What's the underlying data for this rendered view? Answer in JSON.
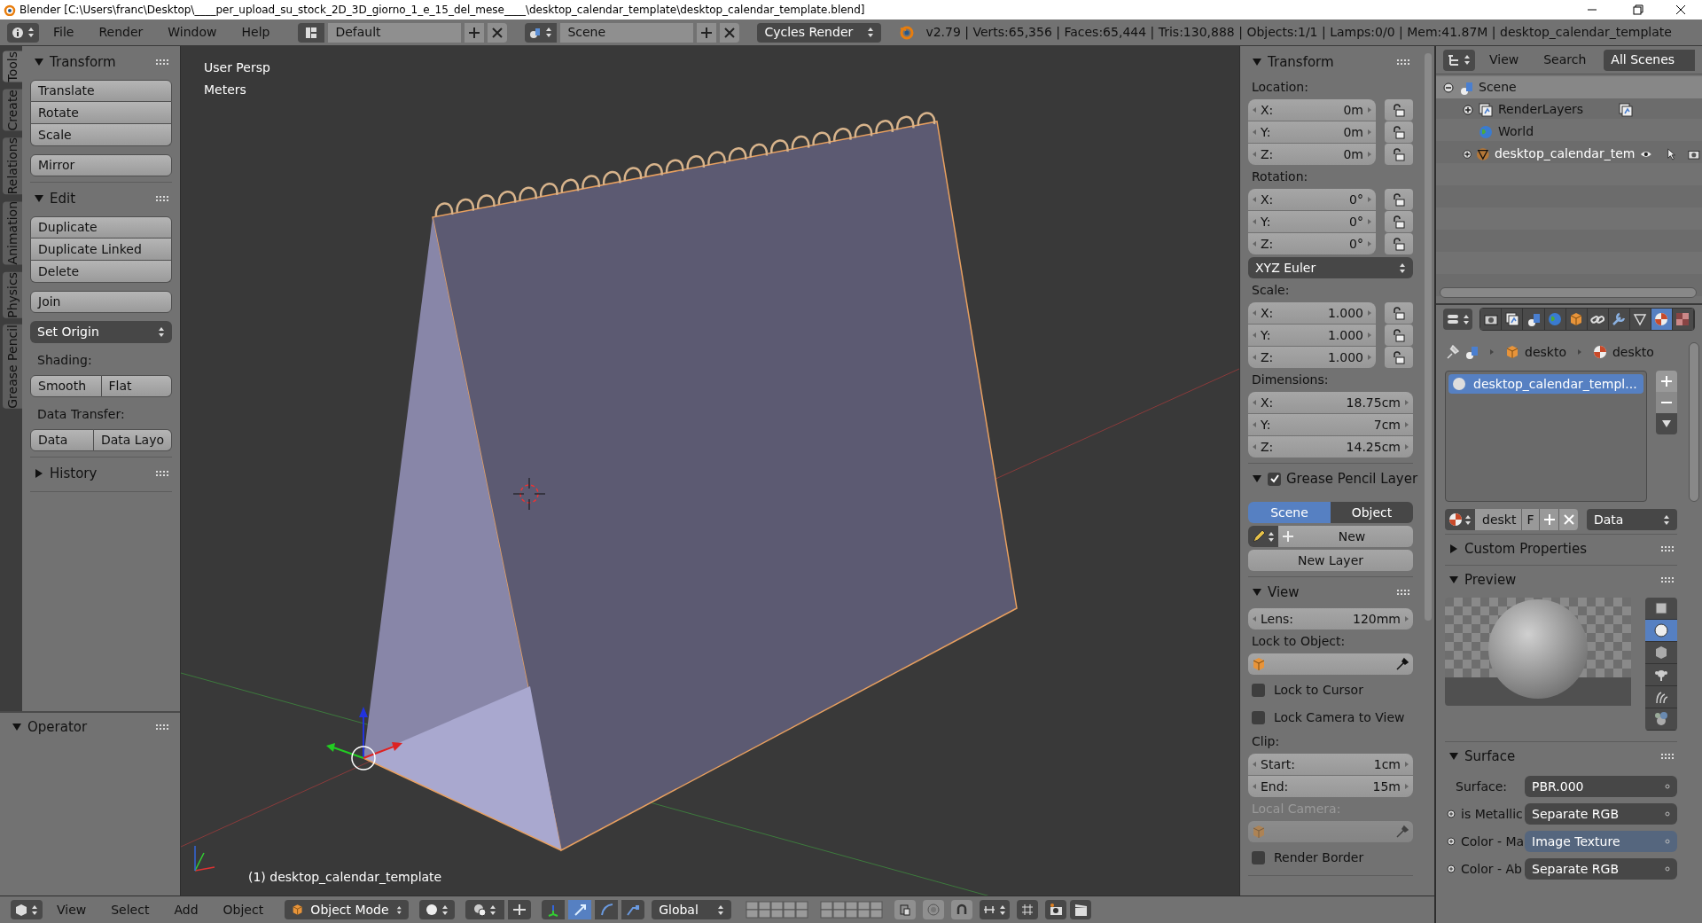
{
  "title_bar": {
    "title": "Blender [C:\\Users\\franc\\Desktop\\____per_upload_su_stock_2D_3D_giorno_1_e_15_del_mese____\\desktop_calendar_template\\desktop_calendar_template.blend]"
  },
  "info_header": {
    "menus": [
      "File",
      "Render",
      "Window",
      "Help"
    ],
    "screen_layout": "Default",
    "scene": "Scene",
    "render_engine": "Cycles Render",
    "stats": "v2.79 | Verts:65,356 | Faces:65,444 | Tris:130,888 | Objects:1/1 | Lamps:0/0 | Mem:41.87M | desktop_calendar_template"
  },
  "tool_tabs": [
    {
      "label": "Tools",
      "selected": true
    },
    {
      "label": "Create",
      "selected": false
    },
    {
      "label": "Relations",
      "selected": false
    },
    {
      "label": "Animation",
      "selected": false
    },
    {
      "label": "Physics",
      "selected": false
    },
    {
      "label": "Grease Pencil",
      "selected": false
    }
  ],
  "tool_shelf": {
    "panels": [
      {
        "title": "Transform",
        "expanded": true,
        "items": [
          {
            "kind": "column",
            "labels": [
              "Translate",
              "Rotate",
              "Scale"
            ]
          },
          {
            "kind": "column",
            "labels": [
              "Mirror"
            ]
          }
        ]
      },
      {
        "title": "Edit",
        "expanded": true,
        "items": [
          {
            "kind": "column",
            "labels": [
              "Duplicate",
              "Duplicate Linked",
              "Delete"
            ]
          },
          {
            "kind": "column",
            "labels": [
              "Join"
            ]
          },
          {
            "kind": "dropdown",
            "text": "Set Origin"
          },
          {
            "kind": "label",
            "text": "Shading:"
          },
          {
            "kind": "row",
            "labels": [
              "Smooth",
              "Flat"
            ]
          },
          {
            "kind": "label",
            "text": "Data Transfer:"
          },
          {
            "kind": "row",
            "labels": [
              "Data",
              "Data Layo"
            ]
          }
        ]
      },
      {
        "title": "History",
        "expanded": false
      }
    ]
  },
  "operator_panel": {
    "title": "Operator",
    "expanded": true
  },
  "viewport": {
    "view_name": "User Persp",
    "units": "Meters",
    "object_label": "(1) desktop_calendar_template"
  },
  "n_panel": {
    "panels": [
      {
        "title": "Transform",
        "expanded": true,
        "items": [
          {
            "kind": "label",
            "text": "Location:",
            "disabled": false
          },
          {
            "kind": "vector",
            "locks": true,
            "fields": [
              {
                "label": "X:",
                "value": "0m"
              },
              {
                "label": "Y:",
                "value": "0m"
              },
              {
                "label": "Z:",
                "value": "0m"
              }
            ]
          },
          {
            "kind": "label",
            "text": "Rotation:",
            "disabled": false
          },
          {
            "kind": "vector",
            "locks": true,
            "fields": [
              {
                "label": "X:",
                "value": "0°"
              },
              {
                "label": "Y:",
                "value": "0°"
              },
              {
                "label": "Z:",
                "value": "0°"
              }
            ]
          },
          {
            "kind": "dropdown",
            "text": "XYZ Euler"
          },
          {
            "kind": "label",
            "text": "Scale:",
            "disabled": false
          },
          {
            "kind": "vector",
            "locks": true,
            "fields": [
              {
                "label": "X:",
                "value": "1.000"
              },
              {
                "label": "Y:",
                "value": "1.000"
              },
              {
                "label": "Z:",
                "value": "1.000"
              }
            ]
          },
          {
            "kind": "label",
            "text": "Dimensions:",
            "disabled": false
          },
          {
            "kind": "vector",
            "locks": false,
            "fields": [
              {
                "label": "X:",
                "value": "18.75cm"
              },
              {
                "label": "Y:",
                "value": "7cm"
              },
              {
                "label": "Z:",
                "value": "14.25cm"
              }
            ]
          }
        ]
      },
      {
        "title": "Grease Pencil Layer",
        "expanded": true,
        "checked": true,
        "items": [
          {
            "kind": "toggle_row",
            "options": [
              {
                "label": "Scene",
                "selected": true
              },
              {
                "label": "Object",
                "selected": false
              }
            ]
          },
          {
            "kind": "new_row",
            "text": "New"
          },
          {
            "kind": "button",
            "text": "New Layer"
          }
        ]
      },
      {
        "title": "View",
        "expanded": true,
        "items": [
          {
            "kind": "vector",
            "locks": false,
            "fields": [
              {
                "label": "Lens:",
                "value": "120mm"
              }
            ]
          },
          {
            "kind": "label",
            "text": "Lock to Object:",
            "disabled": false
          },
          {
            "kind": "object_field",
            "disabled": false
          },
          {
            "kind": "checkbox",
            "label": "Lock to Cursor",
            "checked": false
          },
          {
            "kind": "checkbox",
            "label": "Lock Camera to View",
            "checked": false
          },
          {
            "kind": "label",
            "text": "Clip:",
            "disabled": false
          },
          {
            "kind": "vector",
            "locks": false,
            "fields": [
              {
                "label": "Start:",
                "value": "1cm"
              },
              {
                "label": "End:",
                "value": "15m"
              }
            ]
          },
          {
            "kind": "label",
            "text": "Local Camera:",
            "disabled": true
          },
          {
            "kind": "object_field",
            "disabled": true
          },
          {
            "kind": "checkbox",
            "label": "Render Border",
            "checked": false
          }
        ]
      }
    ]
  },
  "outliner": {
    "menus": [
      "View",
      "Search"
    ],
    "filter": "All Scenes",
    "tree": [
      {
        "label": "Scene",
        "kind": "scene",
        "expanded": true,
        "selected": true,
        "children": [
          {
            "label": "RenderLayers",
            "kind": "render_layers",
            "expanded": false,
            "selected": false
          },
          {
            "label": "World",
            "kind": "world",
            "selected": false
          },
          {
            "label": "desktop_calendar_tem",
            "kind": "mesh_object",
            "expanded": false,
            "selected": false
          }
        ]
      }
    ]
  },
  "properties": {
    "tabs": [
      {
        "kind": "render",
        "selected": false
      },
      {
        "kind": "render_layers",
        "selected": false
      },
      {
        "kind": "scene",
        "selected": false
      },
      {
        "kind": "world",
        "selected": false
      },
      {
        "kind": "object",
        "selected": false
      },
      {
        "kind": "constraints",
        "selected": false
      },
      {
        "kind": "modifiers",
        "selected": false
      },
      {
        "kind": "data",
        "selected": false
      },
      {
        "kind": "material",
        "selected": true
      },
      {
        "kind": "texture",
        "selected": false
      }
    ],
    "breadcrumb": [
      {
        "kind": "object",
        "label": "deskto"
      },
      {
        "kind": "material",
        "label": "deskto"
      }
    ],
    "slots": [
      {
        "name": "desktop_calendar_templ...",
        "selected": true
      }
    ],
    "datablock": {
      "name": "deskt",
      "fake_user": "F",
      "link": "Data"
    },
    "panels": [
      {
        "title": "Custom Properties",
        "expanded": false
      },
      {
        "title": "Preview",
        "expanded": true,
        "preview_types": [
          {
            "kind": "plane",
            "selected": false
          },
          {
            "kind": "sphere",
            "selected": true
          },
          {
            "kind": "cube",
            "selected": false
          },
          {
            "kind": "monkey",
            "selected": false
          },
          {
            "kind": "hair",
            "selected": false
          },
          {
            "kind": "sphere_sky",
            "selected": false
          }
        ]
      },
      {
        "title": "Surface",
        "expanded": true,
        "rows": [
          {
            "label": "Surface:",
            "value": "PBR.000",
            "socket": false,
            "highlighted": false
          },
          {
            "label": "is Metallic",
            "value": "Separate RGB",
            "socket": true,
            "highlighted": false
          },
          {
            "label": "Color - Ma",
            "value": "Image Texture",
            "socket": true,
            "highlighted": true
          },
          {
            "label": "Color - Ab",
            "value": "Separate RGB",
            "socket": true,
            "highlighted": false
          }
        ]
      }
    ]
  },
  "view3d_header": {
    "menus": [
      "View",
      "Select",
      "Add",
      "Object"
    ],
    "mode": "Object Mode",
    "orientation": "Global"
  }
}
